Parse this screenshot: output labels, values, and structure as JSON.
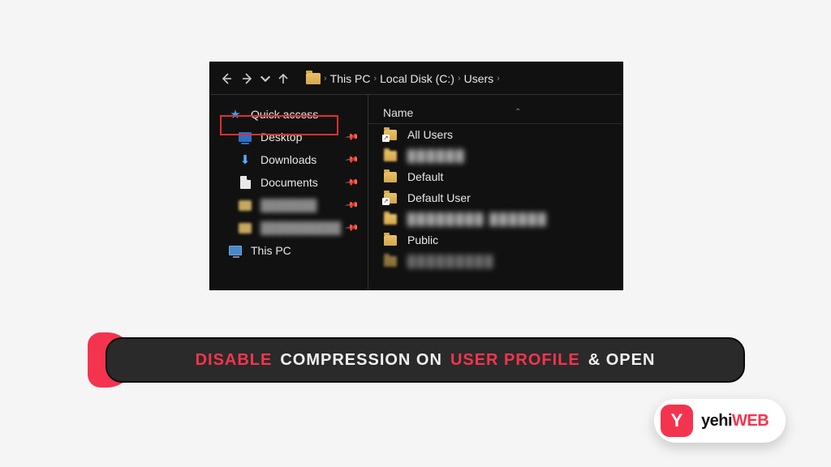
{
  "breadcrumb": {
    "items": [
      "This PC",
      "Local Disk (C:)",
      "Users"
    ]
  },
  "sidebar": {
    "quick_access": "Quick access",
    "desktop": "Desktop",
    "downloads": "Downloads",
    "documents": "Documents",
    "blurred1": "███████",
    "blurred2": "██████████",
    "this_pc": "This PC"
  },
  "content": {
    "column_header": "Name",
    "items": {
      "all_users": "All Users",
      "highlighted_blur": "██████",
      "default": "Default",
      "default_user": "Default User",
      "blur4": "████████ ██████",
      "public": "Public",
      "blur6": "█████████"
    }
  },
  "caption": {
    "w1": "DISABLE",
    "w2": "COMPRESSION ON",
    "w3": "USER PROFILE",
    "w4": "& OPEN"
  },
  "logo": {
    "badge": "Y",
    "part1": "yehi",
    "part2": "WEB"
  }
}
